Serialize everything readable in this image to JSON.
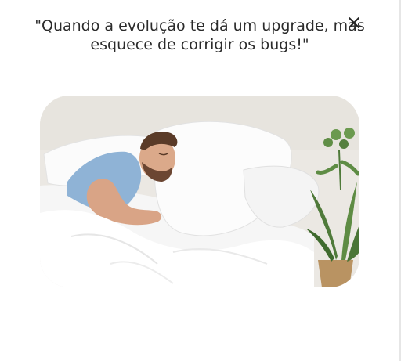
{
  "modal": {
    "quote_text": "\"Quando a evolução te dá um upgrade, mas esquece de corrigir os bugs!\"",
    "close_icon": "close-icon",
    "image": {
      "subject": "man-sleeping-in-bed-photo"
    }
  },
  "colors": {
    "text": "#2b2b2b",
    "background": "#ffffff",
    "wall": "#ece9e4",
    "sheets": "#f7f7f7",
    "shirt": "#8fb3d6",
    "plant": "#4f7a3a"
  }
}
